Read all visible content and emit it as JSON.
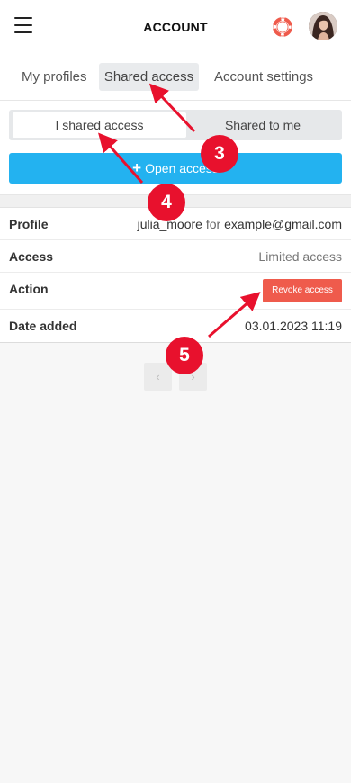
{
  "header": {
    "title": "ACCOUNT",
    "menu_icon": "hamburger-menu-icon",
    "help_icon": "lifebuoy-icon",
    "avatar_icon": "user-avatar",
    "help_color": "#ef5b4c"
  },
  "tabs": [
    {
      "label": "My profiles"
    },
    {
      "label": "Shared access",
      "active": true
    },
    {
      "label": "Account settings"
    }
  ],
  "segment": {
    "left": "I shared access",
    "right": "Shared to me",
    "selected": "I shared access"
  },
  "open_button": {
    "label": "Open access",
    "icon": "plus-icon",
    "color": "#23b2f0"
  },
  "details": {
    "profile": {
      "label": "Profile",
      "name": "julia_moore",
      "connector": "for",
      "email": "example@gmail.com"
    },
    "access": {
      "label": "Access",
      "value": "Limited access"
    },
    "action": {
      "label": "Action",
      "button": "Revoke access",
      "button_color": "#ef5b4c"
    },
    "date": {
      "label": "Date added",
      "value": "03.01.2023 11:19"
    }
  },
  "pager": {
    "prev": "‹",
    "next": "›"
  },
  "annotations": {
    "color": "#e8112d",
    "badges": [
      "3",
      "4",
      "5"
    ]
  }
}
